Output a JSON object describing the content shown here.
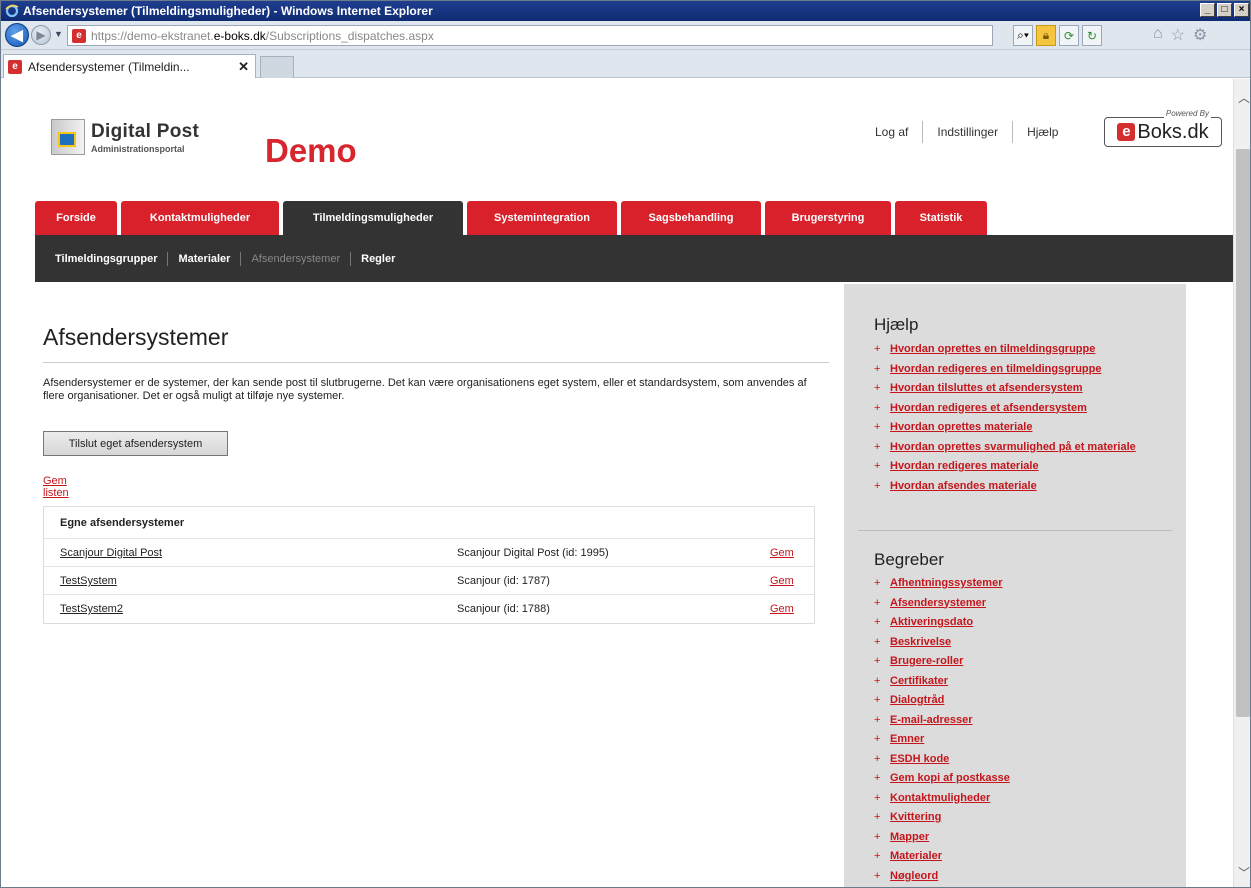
{
  "window": {
    "title": "Afsendersystemer (Tilmeldingsmuligheder) - Windows Internet Explorer"
  },
  "browser": {
    "url_prefix": "https://demo-ekstranet.",
    "url_domain": "e-boks.dk",
    "url_path": "/Subscriptions_dispatches.aspx",
    "tab_label": "Afsendersystemer (Tilmeldin..."
  },
  "header": {
    "logo_title": "Digital Post",
    "logo_subtitle": "Administrationsportal",
    "env_label": "Demo",
    "links": [
      "Log af",
      "Indstillinger",
      "Hjælp"
    ],
    "eboks_powered": "Powered By",
    "eboks_text": "Boks.dk"
  },
  "main_nav": [
    {
      "label": "Forside",
      "width": 82
    },
    {
      "label": "Kontaktmuligheder",
      "width": 158
    },
    {
      "label": "Tilmeldingsmuligheder",
      "width": 180
    },
    {
      "label": "Systemintegration",
      "width": 150
    },
    {
      "label": "Sagsbehandling",
      "width": 140
    },
    {
      "label": "Brugerstyring",
      "width": 126
    },
    {
      "label": "Statistik",
      "width": 92
    }
  ],
  "sub_nav": [
    "Tilmeldingsgrupper",
    "Materialer",
    "Afsendersystemer",
    "Regler"
  ],
  "page": {
    "title": "Afsendersystemer",
    "intro": "Afsendersystemer er de systemer, der kan sende post til slutbrugerne. Det kan være organisationens eget system, eller et standardsystem, som anvendes af flere organisationer. Det er også muligt at tilføje nye systemer.",
    "connect_button": "Tilslut eget afsendersystem",
    "save_list_link": "Gem listen",
    "table_header": "Egne afsendersystemer",
    "rows": [
      {
        "name": "Scanjour Digital Post",
        "info": "Scanjour Digital Post (id: 1995)",
        "action": "Gem"
      },
      {
        "name": "TestSystem",
        "info": "Scanjour (id: 1787)",
        "action": "Gem"
      },
      {
        "name": "TestSystem2",
        "info": "Scanjour (id: 1788)",
        "action": "Gem"
      }
    ]
  },
  "sidebar": {
    "help_title": "Hjælp",
    "help_links": [
      "Hvordan oprettes en tilmeldingsgruppe",
      "Hvordan redigeres en tilmeldingsgruppe",
      "Hvordan tilsluttes et afsendersystem",
      "Hvordan redigeres et afsendersystem",
      "Hvordan oprettes materiale",
      "Hvordan oprettes svarmulighed på et materiale",
      "Hvordan redigeres materiale",
      "Hvordan afsendes materiale"
    ],
    "terms_title": "Begreber",
    "terms": [
      "Afhentningssystemer",
      "Afsendersystemer",
      "Aktiveringsdato",
      "Beskrivelse",
      "Brugere-roller",
      "Certifikater",
      "Dialogtråd",
      "E-mail-adresser",
      "Emner",
      "ESDH kode",
      "Gem kopi af postkasse",
      "Kontaktmuligheder",
      "Kvittering",
      "Mapper",
      "Materialer",
      "Nøgleord"
    ]
  },
  "colors": {
    "brand_red": "#d9212b",
    "nav_dark": "#333333",
    "link_red": "#c4161c",
    "sidebar_bg": "#dcdcdc"
  }
}
